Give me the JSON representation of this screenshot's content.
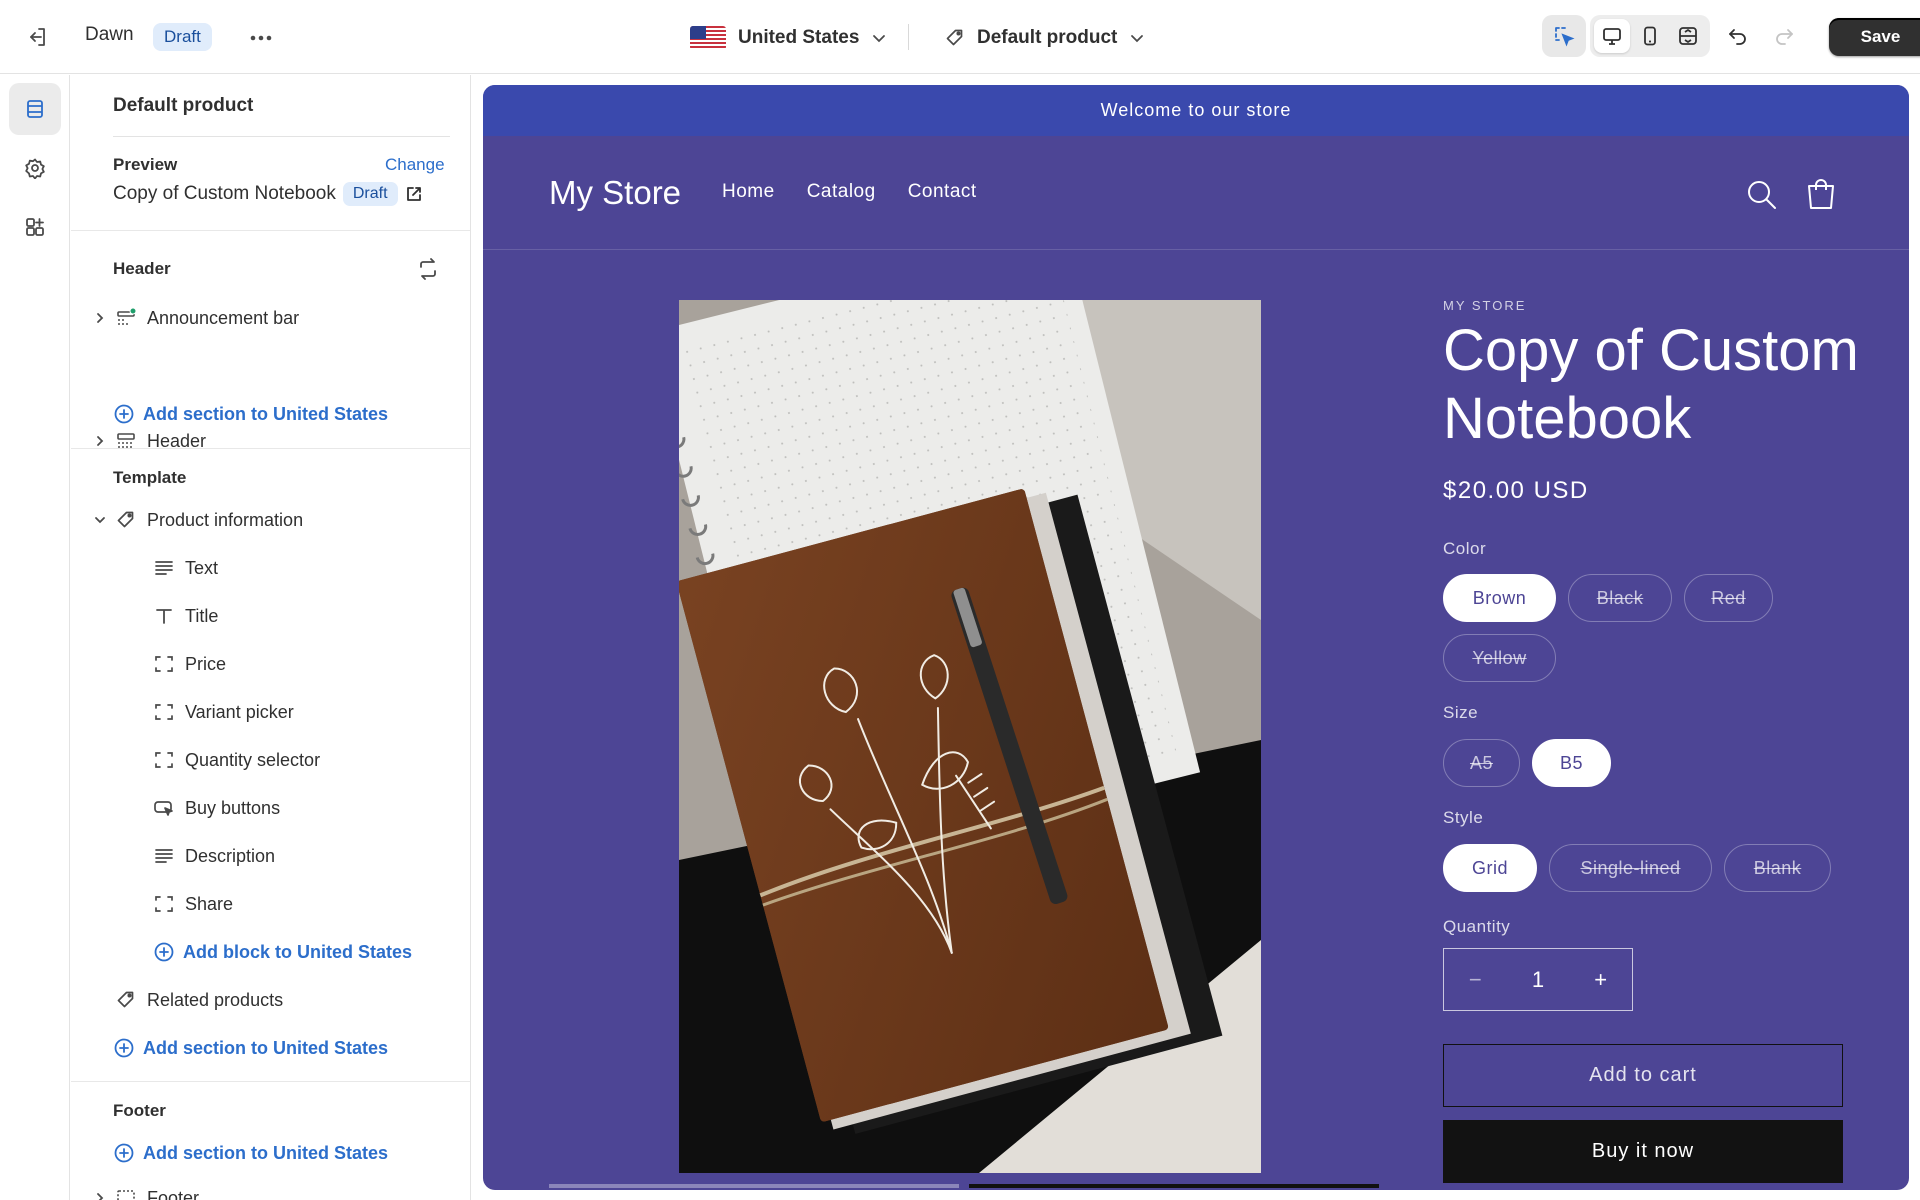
{
  "topbar": {
    "theme_name": "Dawn",
    "theme_status": "Draft",
    "country": "United States",
    "template": "Default product",
    "save_label": "Save"
  },
  "sidebar": {
    "title": "Default product",
    "preview": {
      "label": "Preview",
      "change_label": "Change",
      "product_name": "Copy of Custom Notebook",
      "status": "Draft"
    },
    "header_group": {
      "title": "Header",
      "items": [
        {
          "label": "Announcement bar",
          "icon": "announcement-bar-icon"
        },
        {
          "label": "Header",
          "icon": "header-layout-icon"
        }
      ],
      "add_label": "Add section to United States"
    },
    "template_group": {
      "title": "Template",
      "section_label": "Product information",
      "blocks": [
        {
          "label": "Text",
          "icon": "text-lines-icon"
        },
        {
          "label": "Title",
          "icon": "title-text-icon"
        },
        {
          "label": "Price",
          "icon": "block-frame-icon"
        },
        {
          "label": "Variant picker",
          "icon": "block-frame-icon"
        },
        {
          "label": "Quantity selector",
          "icon": "block-frame-icon"
        },
        {
          "label": "Buy buttons",
          "icon": "buy-button-icon"
        },
        {
          "label": "Description",
          "icon": "text-lines-icon"
        },
        {
          "label": "Share",
          "icon": "block-frame-icon"
        }
      ],
      "add_block_label": "Add block to United States",
      "related_label": "Related products",
      "add_section_label": "Add section to United States"
    },
    "footer_group": {
      "title": "Footer",
      "add_label": "Add section to United States",
      "item_label": "Footer"
    }
  },
  "store": {
    "announcement": "Welcome to our store",
    "name": "My Store",
    "nav": [
      "Home",
      "Catalog",
      "Contact"
    ],
    "colors": {
      "background": "#4d4595",
      "announcement": "#3a49ad"
    }
  },
  "product": {
    "vendor": "MY STORE",
    "title": "Copy of Custom Notebook",
    "price": "$20.00 USD",
    "color_label": "Color",
    "colors": [
      "Brown",
      "Black",
      "Red",
      "Yellow"
    ],
    "size_label": "Size",
    "sizes": [
      "A5",
      "B5"
    ],
    "style_label": "Style",
    "styles": [
      "Grid",
      "Single-lined",
      "Blank"
    ],
    "quantity_label": "Quantity",
    "quantity_value": "1",
    "minus": "−",
    "plus": "+",
    "add_to_cart": "Add to cart",
    "buy_now": "Buy it now"
  }
}
